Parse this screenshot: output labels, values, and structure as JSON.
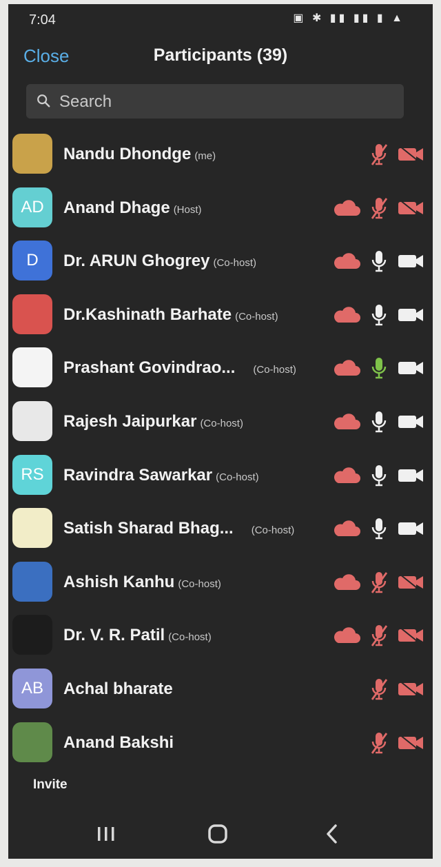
{
  "status_bar": {
    "time": "7:04",
    "icons": "▣ ✱ ▮▮ ▮▮ ▮ ▲"
  },
  "header": {
    "close_label": "Close",
    "title": "Participants (39)"
  },
  "search": {
    "placeholder": "Search"
  },
  "colors": {
    "accent": "#5aaee6",
    "muted_red": "#e06a68",
    "unmuted_white": "#f0f0f0",
    "speaking_green": "#7fc24a",
    "background": "#262626"
  },
  "participants": [
    {
      "name": "Nandu Dhondge",
      "tag": "(me)",
      "avatar_initials": "",
      "avatar_color": "#c9a24a",
      "cloud": false,
      "mic": "muted",
      "video": "off"
    },
    {
      "name": "Anand Dhage",
      "tag": "(Host)",
      "avatar_initials": "AD",
      "avatar_color": "#64cfd2",
      "cloud": true,
      "mic": "muted",
      "video": "off"
    },
    {
      "name": "Dr. ARUN Ghogrey",
      "tag": "(Co-host)",
      "avatar_initials": "D",
      "avatar_color": "#3f72d8",
      "cloud": true,
      "mic": "on",
      "video": "on"
    },
    {
      "name": "Dr.Kashinath Barhate",
      "tag": "(Co-host)",
      "avatar_initials": "",
      "avatar_color": "#d9534f",
      "cloud": true,
      "mic": "on",
      "video": "on"
    },
    {
      "name": "Prashant Govindrao...",
      "tag": "(Co-host)",
      "avatar_initials": "",
      "avatar_color": "#f4f4f4",
      "cloud": true,
      "mic": "speaking",
      "video": "on"
    },
    {
      "name": "Rajesh Jaipurkar",
      "tag": "(Co-host)",
      "avatar_initials": "",
      "avatar_color": "#e8e8e8",
      "cloud": true,
      "mic": "on",
      "video": "on"
    },
    {
      "name": "Ravindra Sawarkar",
      "tag": "(Co-host)",
      "avatar_initials": "RS",
      "avatar_color": "#5fd4d8",
      "cloud": true,
      "mic": "on",
      "video": "on"
    },
    {
      "name": "Satish Sharad Bhag...",
      "tag": "(Co-host)",
      "avatar_initials": "",
      "avatar_color": "#f2edc8",
      "cloud": true,
      "mic": "on",
      "video": "on"
    },
    {
      "name": "Ashish Kanhu",
      "tag": "(Co-host)",
      "avatar_initials": "",
      "avatar_color": "#3b6fc0",
      "cloud": true,
      "mic": "muted",
      "video": "off"
    },
    {
      "name": "Dr. V. R. Patil",
      "tag": "(Co-host)",
      "avatar_initials": "",
      "avatar_color": "#1c1c1c",
      "cloud": true,
      "mic": "muted",
      "video": "off"
    },
    {
      "name": "Achal bharate",
      "tag": "",
      "avatar_initials": "AB",
      "avatar_color": "#8f96d8",
      "cloud": false,
      "mic": "muted",
      "video": "off"
    },
    {
      "name": "Anand Bakshi",
      "tag": "",
      "avatar_initials": "",
      "avatar_color": "#5f8a4a",
      "cloud": false,
      "mic": "muted",
      "video": "off"
    }
  ],
  "footer": {
    "invite_label": "Invite"
  },
  "nav": {
    "recent_icon": "recent-apps-icon",
    "home_icon": "home-icon",
    "back_icon": "back-icon"
  }
}
